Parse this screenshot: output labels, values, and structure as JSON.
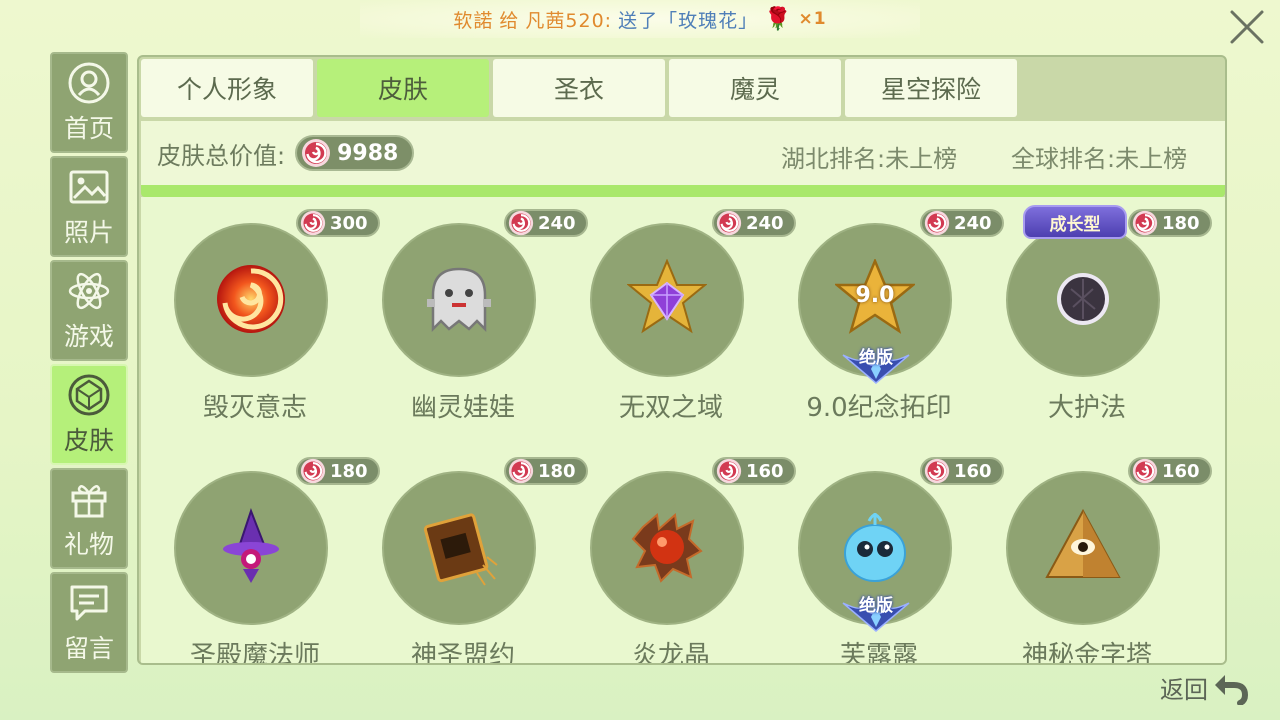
{
  "banner": {
    "sender": "软諾",
    "mid": "给",
    "receiver": "凡茜520:",
    "message": "送了「玫瑰花」",
    "gift_icon": "rose-icon",
    "count": "×1"
  },
  "sidebar": {
    "items": [
      {
        "label": "首页",
        "icon": "profile-icon"
      },
      {
        "label": "照片",
        "icon": "photo-icon"
      },
      {
        "label": "游戏",
        "icon": "atom-icon"
      },
      {
        "label": "皮肤",
        "icon": "gem-icon",
        "active": true
      },
      {
        "label": "礼物",
        "icon": "gift-icon"
      },
      {
        "label": "留言",
        "icon": "message-icon"
      }
    ]
  },
  "tabs": [
    {
      "label": "个人形象"
    },
    {
      "label": "皮肤",
      "active": true
    },
    {
      "label": "圣衣"
    },
    {
      "label": "魔灵"
    },
    {
      "label": "星空探险"
    }
  ],
  "summary": {
    "label": "皮肤总价值:",
    "value": "9988",
    "hubei_rank": "湖北排名:未上榜",
    "global_rank": "全球排名:未上榜"
  },
  "skins": [
    {
      "name": "毁灭意志",
      "price": "300",
      "art": "swirl-icon"
    },
    {
      "name": "幽灵娃娃",
      "price": "240",
      "art": "ghost-icon"
    },
    {
      "name": "无双之域",
      "price": "240",
      "art": "star-gem-icon"
    },
    {
      "name": "9.0纪念拓印",
      "price": "240",
      "art": "star-9-icon",
      "badge_bottom": "绝版",
      "badge_label": "9.0"
    },
    {
      "name": "大护法",
      "price": "180",
      "art": "dark-orb-icon",
      "badge_top": "成长型"
    },
    {
      "name": "圣殿魔法师",
      "price": "180",
      "art": "wizard-icon"
    },
    {
      "name": "神圣盟约",
      "price": "180",
      "art": "book-icon"
    },
    {
      "name": "炎龙晶",
      "price": "160",
      "art": "dragon-gem-icon"
    },
    {
      "name": "芙露露",
      "price": "160",
      "art": "blue-jelly-icon",
      "badge_bottom": "绝版"
    },
    {
      "name": "神秘金字塔",
      "price": "160",
      "art": "pyramid-eye-icon"
    }
  ],
  "footer": {
    "back_label": "返回"
  },
  "colors": {
    "accent_green": "#b6f07a",
    "panel": "#c9d8a8",
    "circle": "#8fa372",
    "coin": "#d23a52"
  }
}
